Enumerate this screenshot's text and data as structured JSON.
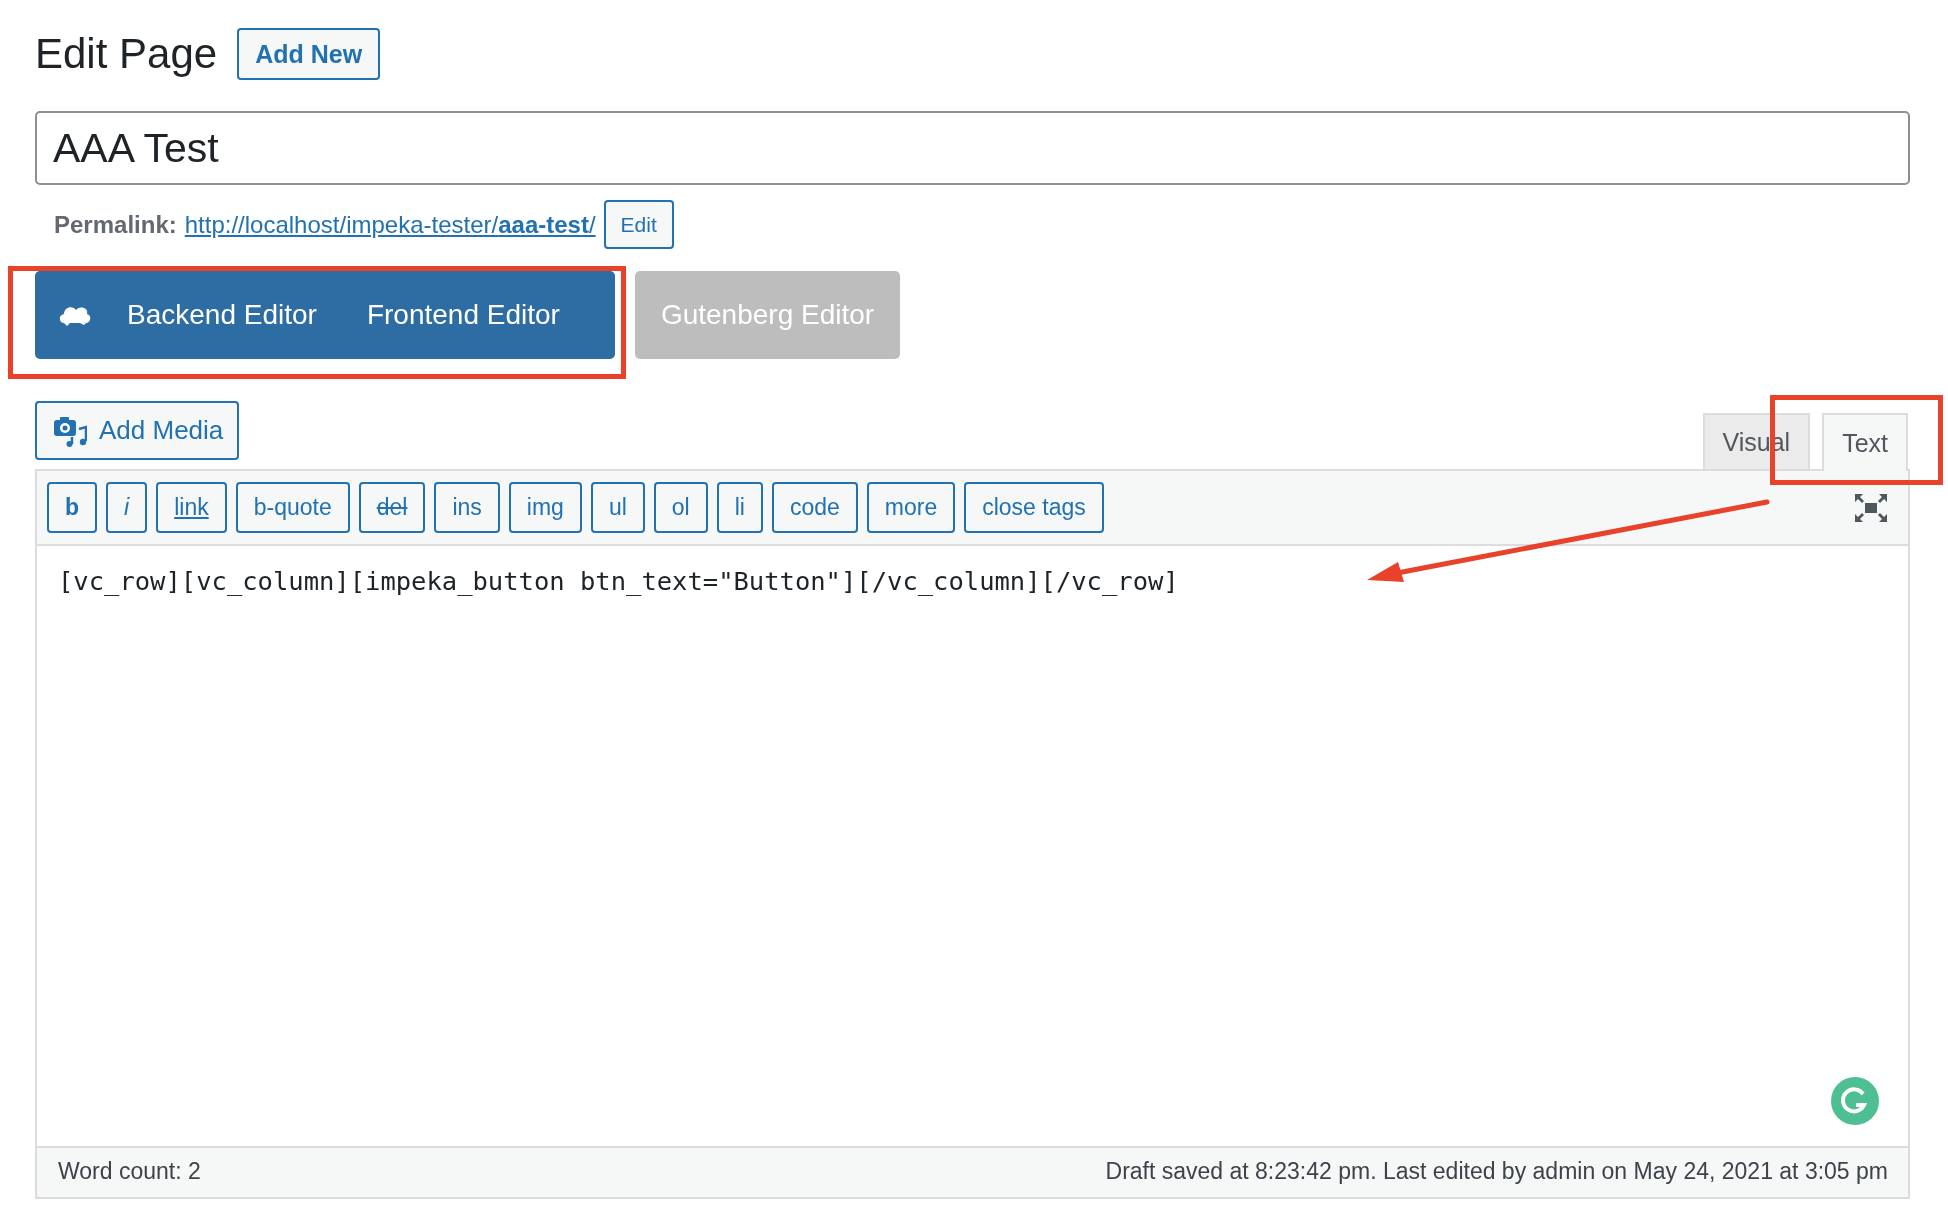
{
  "heading": "Edit Page",
  "add_new": "Add New",
  "title_field": {
    "value": "AAA Test"
  },
  "permalink": {
    "label": "Permalink:",
    "url": "http://localhost/impeka-tester/**aaa-test**/",
    "edit": "Edit"
  },
  "editor_switch": [
    {
      "label": "Backend Editor",
      "kind": "primary"
    },
    {
      "label": "Frontend Editor",
      "kind": "primary"
    },
    {
      "label": "Gutenberg Editor",
      "kind": "muted"
    }
  ],
  "add_media": "Add Media",
  "tabs": [
    {
      "label": "Visual",
      "selected": false
    },
    {
      "label": "Text",
      "selected": true
    }
  ],
  "toolbar": [
    {
      "label": "b",
      "kind": "bold"
    },
    {
      "label": "i",
      "kind": "italic"
    },
    {
      "label": "link",
      "kind": "underline"
    },
    {
      "label": "b-quote",
      "kind": "plain"
    },
    {
      "label": "del",
      "kind": "strike"
    },
    {
      "label": "ins",
      "kind": "plain"
    },
    {
      "label": "img",
      "kind": "plain"
    },
    {
      "label": "ul",
      "kind": "plain"
    },
    {
      "label": "ol",
      "kind": "plain"
    },
    {
      "label": "li",
      "kind": "plain"
    },
    {
      "label": "code",
      "kind": "plain"
    },
    {
      "label": "more",
      "kind": "plain"
    },
    {
      "label": "close tags",
      "kind": "plain"
    }
  ],
  "content": "[vc_row][vc_column][impeka_button btn_text=\"Button\"][/vc_column][/vc_row]",
  "status_bar": {
    "word_count": "Word count: 2",
    "saved": "Draft saved at 8:23:42 pm. Last edited by admin on May 24, 2021 at 3:05 pm"
  }
}
